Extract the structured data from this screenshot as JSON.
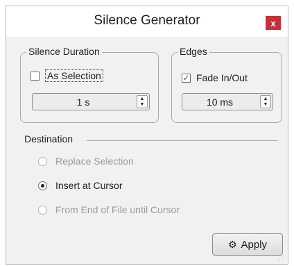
{
  "window": {
    "title": "Silence Generator",
    "close_glyph": "x",
    "close_color": "#c6303b"
  },
  "silence_duration": {
    "group_label": "Silence Duration",
    "as_selection_label": "As Selection",
    "as_selection_checked": false,
    "duration_value": "1 s"
  },
  "edges": {
    "group_label": "Edges",
    "fade_label": "Fade In/Out",
    "fade_checked": true,
    "fade_value": "10 ms"
  },
  "destination": {
    "label": "Destination",
    "options": [
      {
        "label": "Replace Selection",
        "selected": false,
        "enabled": false
      },
      {
        "label": "Insert at Cursor",
        "selected": true,
        "enabled": true
      },
      {
        "label": "From End of File until Cursor",
        "selected": false,
        "enabled": false
      }
    ]
  },
  "actions": {
    "apply_label": "Apply",
    "apply_icon": "gears-icon"
  }
}
